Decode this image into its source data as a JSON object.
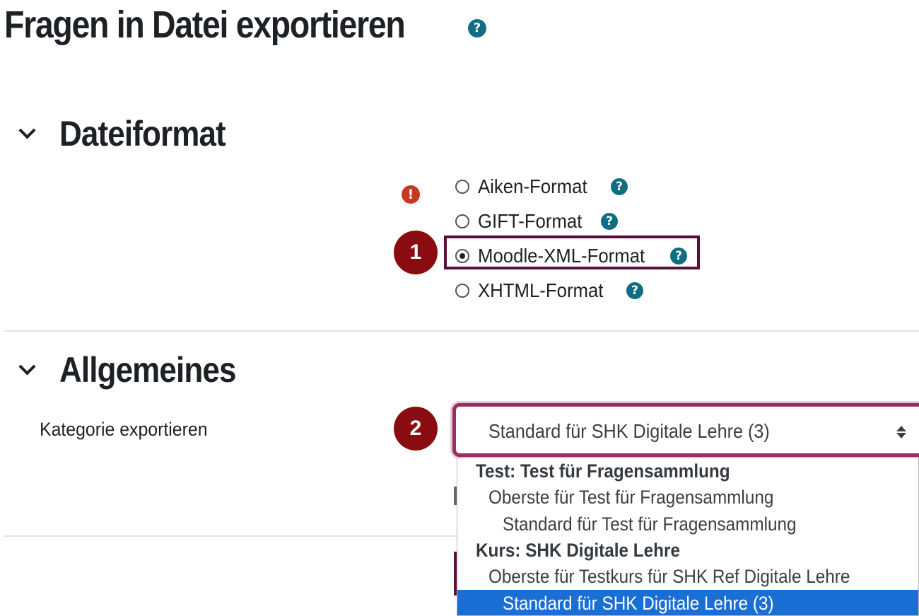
{
  "page": {
    "title": "Fragen in Datei exportieren"
  },
  "sections": {
    "file_format": {
      "title": "Dateiformat",
      "options": [
        {
          "label": "Aiken-Format",
          "checked": false
        },
        {
          "label": "GIFT-Format",
          "checked": false
        },
        {
          "label": "Moodle-XML-Format",
          "checked": true
        },
        {
          "label": "XHTML-Format",
          "checked": false
        }
      ]
    },
    "general": {
      "title": "Allgemeines",
      "category_label": "Kategorie exportieren",
      "category_selected": "Standard für SHK Digitale Lehre (3)",
      "dropdown": {
        "groups": [
          {
            "label": "Test: Test für Fragensammlung",
            "options": [
              "Oberste für Test für Fragensammlung",
              "Standard für Test für Fragensammlung"
            ]
          },
          {
            "label": "Kurs: SHK Digitale Lehre",
            "options": [
              "Oberste für Testkurs für SHK Ref Digitale Lehre",
              "Standard für SHK Digitale Lehre (3)"
            ]
          }
        ]
      }
    }
  },
  "annotations": {
    "step1": "1",
    "step2": "2"
  },
  "icons": {
    "help": "question-circle-icon",
    "error": "exclamation-circle-icon",
    "section_toggle": "chevron-down-icon"
  },
  "colors": {
    "accent": "#0f6e84",
    "error": "#c8371f",
    "badge": "#8a0c10",
    "highlight_border": "#5a0f3a",
    "dropdown_selected": "#1a6fd6"
  }
}
